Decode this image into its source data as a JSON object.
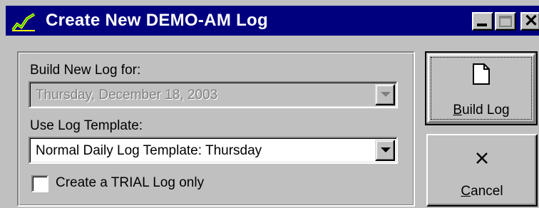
{
  "window": {
    "title": "Create New DEMO-AM Log"
  },
  "title_buttons": {
    "minimize_icon": "minimize-icon",
    "maximize_icon": "maximize-icon",
    "close_icon": "close-icon"
  },
  "form": {
    "build_for_label": "Build New Log for:",
    "build_for_value": "Thursday, December 18, 2003",
    "template_label": "Use Log Template:",
    "template_value": "Normal Daily Log Template: Thursday",
    "trial_label": "Create a TRIAL Log only",
    "trial_checked": false
  },
  "buttons": {
    "build_first": "B",
    "build_rest": "uild Log",
    "cancel_first": "C",
    "cancel_rest": "ancel"
  },
  "colors": {
    "titlebar": "#00007f",
    "face": "#c0c0c0"
  }
}
